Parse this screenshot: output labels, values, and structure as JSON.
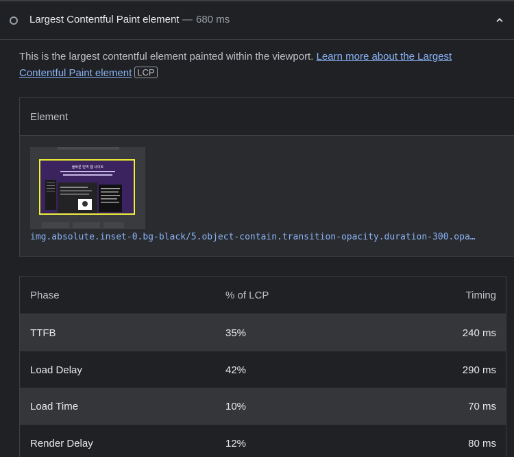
{
  "audit": {
    "title": "Largest Contentful Paint element",
    "separator": "—",
    "value": "680 ms",
    "expanded": true
  },
  "description": {
    "text": "This is the largest contentful element painted within the viewport. ",
    "link_text": "Learn more about the Largest Contentful Paint element",
    "badge": "LCP"
  },
  "element_table": {
    "header": "Element",
    "selector": "img.absolute.inset-0.bg-black/5.object-contain.transition-opacity.duration-300.opa…",
    "thumbnail": {
      "heading": "올바른 번역 웹 사이트",
      "highlight_color": "#f2f23a",
      "background_color": "#2e1a4a"
    }
  },
  "phase_table": {
    "headers": [
      "Phase",
      "% of LCP",
      "Timing"
    ],
    "rows": [
      {
        "phase": "TTFB",
        "percent": "35%",
        "timing": "240 ms"
      },
      {
        "phase": "Load Delay",
        "percent": "42%",
        "timing": "290 ms"
      },
      {
        "phase": "Load Time",
        "percent": "10%",
        "timing": "70 ms"
      },
      {
        "phase": "Render Delay",
        "percent": "12%",
        "timing": "80 ms"
      }
    ]
  },
  "colors": {
    "background": "#202124",
    "link": "#8ab4f8",
    "row_alt": "#35363a"
  }
}
